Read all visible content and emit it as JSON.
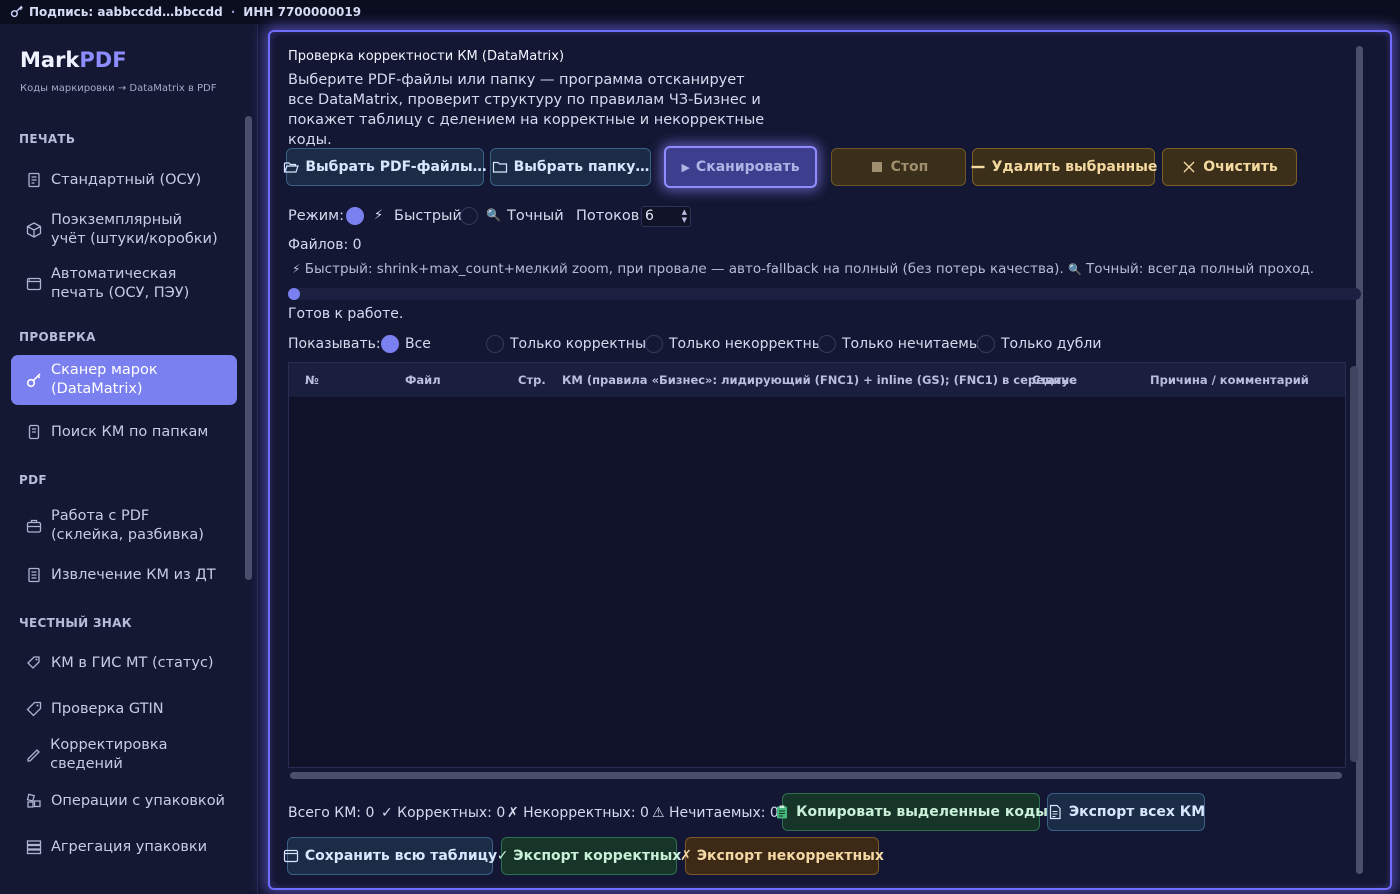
{
  "topbar": {
    "key_icon": "key-icon",
    "signature": "Подпись: aabbccdd…bbccdd",
    "separator": "·",
    "inn": "ИНН 7700000019"
  },
  "brand": {
    "name_main": "Mark",
    "name_accent": "PDF",
    "subtitle": "Коды маркировки → DataMatrix в PDF",
    "accent_color": "#8d8dff"
  },
  "sidebar": {
    "sections": {
      "print": "ПЕЧАТЬ",
      "check": "ПРОВЕРКА",
      "pdf": "PDF",
      "cz": "ЧЕСТНЫЙ ЗНАК"
    },
    "items": [
      {
        "label": "Стандартный (ОСУ)",
        "icon": "document-icon"
      },
      {
        "label": "Поэкземплярный учёт (штуки/коробки)",
        "icon": "cube-icon"
      },
      {
        "label": "Автоматическая печать (ОСУ, ПЭУ)",
        "icon": "window-icon"
      },
      {
        "label": "Сканер марок (DataMatrix)",
        "icon": "key-icon",
        "active": true
      },
      {
        "label": "Поиск КМ по папкам",
        "icon": "folder-search-icon"
      },
      {
        "label": "Работа с PDF (склейка, разбивка)",
        "icon": "briefcase-icon"
      },
      {
        "label": "Извлечение КМ из ДТ",
        "icon": "document-list-icon"
      },
      {
        "label": "КМ в ГИС МТ (статус)",
        "icon": "tags-icon"
      },
      {
        "label": "Проверка GTIN",
        "icon": "tag-icon"
      },
      {
        "label": "Корректировка сведений",
        "icon": "pencil-icon"
      },
      {
        "label": "Операции с упаковкой",
        "icon": "boxes-icon"
      },
      {
        "label": "Агрегация упаковки",
        "icon": "stack-icon"
      }
    ]
  },
  "main": {
    "title": "Проверка корректности КМ (DataMatrix)",
    "description": "Выберите PDF-файлы или папку — программа отсканирует все DataMatrix, проверит структуру по правилам ЧЗ-Бизнес и покажет таблицу с делением на корректные и некорректные коды.",
    "buttons": {
      "choose_files": "Выбрать PDF-файлы…",
      "choose_folder": "Выбрать папку…",
      "scan": "Сканировать",
      "stop": "Стоп",
      "delete_selected": "Удалить выбранные",
      "clear": "Очистить"
    },
    "mode": {
      "label": "Режим:",
      "fast_icon": "⚡",
      "fast": "Быстрый",
      "precise_icon": "🔍",
      "precise": "Точный",
      "selected": "fast",
      "threads_label": "Потоков:",
      "threads_value": "6"
    },
    "files_count": "Файлов: 0",
    "hint_fast_icon": "⚡",
    "hint_fast": "Быстрый: shrink+max_count+мелкий zoom, при провале — авто-fallback на полный (без потерь качества).",
    "hint_precise_icon": "🔍",
    "hint_precise": "Точный: всегда полный проход.",
    "progress_fraction": 0,
    "status": "Готов к работе.",
    "filter": {
      "label": "Показывать:",
      "options": [
        "Все",
        "Только корректные",
        "Только некорректные",
        "Только нечитаемые",
        "Только дубли"
      ],
      "selected": "Все"
    },
    "table": {
      "columns": [
        "№",
        "Файл",
        "Стр.",
        "КМ (правила «Бизнес»: лидирующий (FNC1) + inline (GS); (FNC1) в середине",
        "Статус",
        "Причина / комментарий"
      ],
      "rows": []
    },
    "totals": {
      "all": "Всего КМ: 0",
      "correct": "✓ Корректных: 0",
      "incorrect": "✗ Некорректных: 0",
      "unreadable": "⚠ Нечитаемых: 0"
    },
    "export": {
      "copy_selected": "Копировать выделенные коды",
      "export_all": "Экспорт всех КМ",
      "save_table": "Сохранить всю таблицу",
      "export_correct": "✓ Экспорт корректных",
      "export_incorrect": "✗ Экспорт некорректных"
    },
    "colors": {
      "accent": "#7b80f0",
      "glow": "#6f6cff",
      "background": "#131733"
    }
  }
}
